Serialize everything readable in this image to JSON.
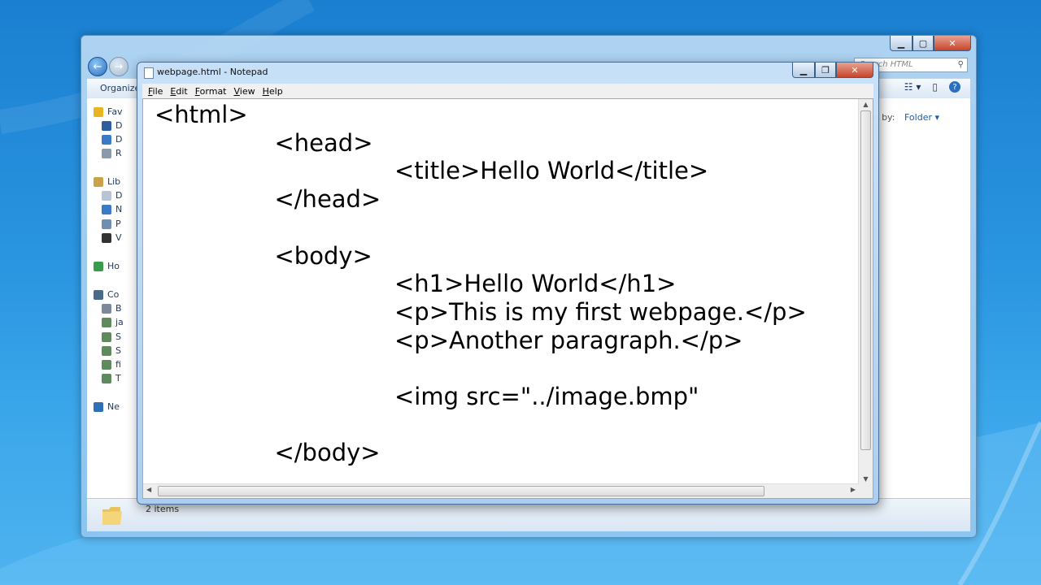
{
  "explorer": {
    "search_placeholder": "Search HTML",
    "toolbar": {
      "organize_label": "Organize"
    },
    "nav_items": [
      {
        "label": "Fav",
        "icon": "star-icon"
      },
      {
        "label": "D",
        "icon": "desktop-icon"
      },
      {
        "label": "D",
        "icon": "downloads-icon"
      },
      {
        "label": "R",
        "icon": "recent-places-icon"
      },
      {
        "label": "Lib",
        "icon": "libraries-icon"
      },
      {
        "label": "D",
        "icon": "documents-icon"
      },
      {
        "label": "N",
        "icon": "music-icon"
      },
      {
        "label": "P",
        "icon": "pictures-icon"
      },
      {
        "label": "V",
        "icon": "videos-icon"
      },
      {
        "label": "Ho",
        "icon": "homegroup-icon"
      },
      {
        "label": "Co",
        "icon": "computer-icon"
      },
      {
        "label": "B",
        "icon": "drive-icon"
      },
      {
        "label": "ja",
        "icon": "network-drive-icon"
      },
      {
        "label": "S",
        "icon": "network-drive-icon"
      },
      {
        "label": "S",
        "icon": "network-drive-icon"
      },
      {
        "label": "fi",
        "icon": "network-drive-icon"
      },
      {
        "label": "T",
        "icon": "network-drive-icon"
      },
      {
        "label": "Ne",
        "icon": "network-icon"
      }
    ],
    "arrange_label": "e by:",
    "arrange_value": "Folder ▾",
    "status_text": "2 items"
  },
  "notepad": {
    "title": "webpage.html - Notepad",
    "menu": [
      {
        "label": "File",
        "u": "F",
        "rest": "ile"
      },
      {
        "label": "Edit",
        "u": "E",
        "rest": "dit"
      },
      {
        "label": "Format",
        "u": "F",
        "rest": "ormat",
        "pre": ""
      },
      {
        "label": "View",
        "u": "V",
        "rest": "iew"
      },
      {
        "label": "Help",
        "u": "H",
        "rest": "elp"
      }
    ],
    "content": "<html>\n                <head>\n                                <title>Hello World</title>\n                </head>\n\n                <body>\n                                <h1>Hello World</h1>\n                                <p>This is my first webpage.</p>\n                                <p>Another paragraph.</p>\n\n                                <img src=\"../image.bmp\"\n\n                </body>"
  },
  "colors": {
    "desktop": "#2a95e0",
    "accent": "#1e5da8"
  }
}
